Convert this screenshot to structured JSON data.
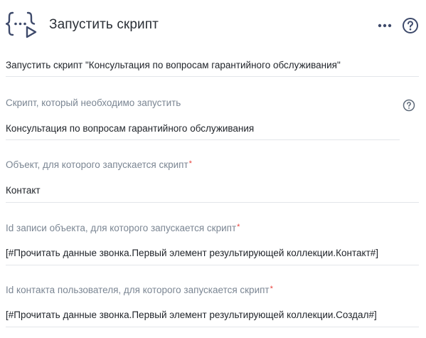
{
  "header": {
    "title": "Запустить скрипт",
    "icon": "script-run-icon",
    "more_icon": "more-horizontal-icon",
    "help_icon": "help-circle-icon"
  },
  "summary": "Запустить скрипт \"Консультация по вопросам гарантийного обслуживания\"",
  "fields": [
    {
      "label": "Скрипт, который необходимо запустить",
      "value": "Консультация по вопросам гарантийного обслуживания",
      "required": false,
      "help_icon": "help-circle-icon"
    },
    {
      "label": "Объект, для которого запускается скрипт",
      "value": "Контакт",
      "required": true
    },
    {
      "label": "Id записи объекта, для которого запускается скрипт",
      "value": "[#Прочитать данные звонка.Первый элемент результирующей коллекции.Контакт#]",
      "required": true
    },
    {
      "label": "Id контакта пользователя, для которого запускается скрипт",
      "value": "[#Прочитать данные звонка.Первый элемент результирующей коллекции.Создал#]",
      "required": true
    }
  ],
  "required_mark": "*",
  "colors": {
    "accent": "#3e4a6b",
    "label": "#7b8693",
    "required": "#e8413b",
    "divider": "#e3e6ea"
  }
}
